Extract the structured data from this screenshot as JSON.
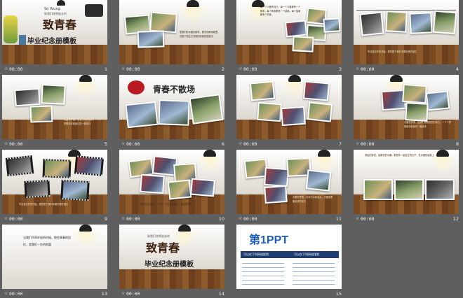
{
  "slides": [
    {
      "num": "1",
      "dur": "00:00",
      "title_small": "So Young",
      "title_sub": "致我们终将逝去的",
      "title_main": "致青春",
      "title_bottom": "毕业纪念册模板"
    },
    {
      "num": "2",
      "dur": "00:00",
      "caption": "愿我们的青春在那年，那天的那场雨里，在那个陌生又熟悉的你我的笑脸中"
    },
    {
      "num": "3",
      "dur": "00:00",
      "caption": "每一个人都有自己、每一个青春都有一个故事，每个故事都有一个结局，每个结局都有个开始"
    },
    {
      "num": "4",
      "dur": "00:00",
      "caption": "毕业是另外的开始，那些属于我们青春的美好回忆"
    },
    {
      "num": "5",
      "dur": "00:00",
      "caption": "青春有梦想，也有汗水和泪水，一个个梦想陪伴着我们的一路前行"
    },
    {
      "num": "6",
      "dur": "00:00",
      "title_main": "青春不散场"
    },
    {
      "num": "7",
      "dur": "00:00"
    },
    {
      "num": "8",
      "dur": "00:00",
      "caption": "青春是梦想，是我们勇敢前进的动力，一个个梦想陪伴着我们一路走来"
    },
    {
      "num": "9",
      "dur": "00:00",
      "caption": "毕业是另外的开始，那些属于我们青春的美好回忆"
    },
    {
      "num": "10",
      "dur": "00:00",
      "caption": "时光总会远去，一个又一个的青春故事，曾经的我们"
    },
    {
      "num": "11",
      "dur": "00:00",
      "caption": "青春有梦想，也有汗水和泪水，青春是勇敢前进的动力"
    },
    {
      "num": "12",
      "dur": "00:00",
      "caption": "曾经的我们，最美好的青春，那些年一起走过的日子，在青春的画卷上"
    },
    {
      "num": "13",
      "dur": "00:00",
      "caption": "当我们不再年轻的时候，那些青春的回忆，是我们一生的财富"
    },
    {
      "num": "14",
      "dur": "00:00",
      "title_sub": "致我们终将逝去的",
      "title_main": "致青春",
      "title_bottom": "毕业纪念册模板"
    },
    {
      "num": "15",
      "dur": "00:00",
      "logo_text": "第1PPT",
      "left_heading": "可以在下列网站找到",
      "right_heading": "可以在下列网站找到"
    }
  ],
  "star": "☆"
}
